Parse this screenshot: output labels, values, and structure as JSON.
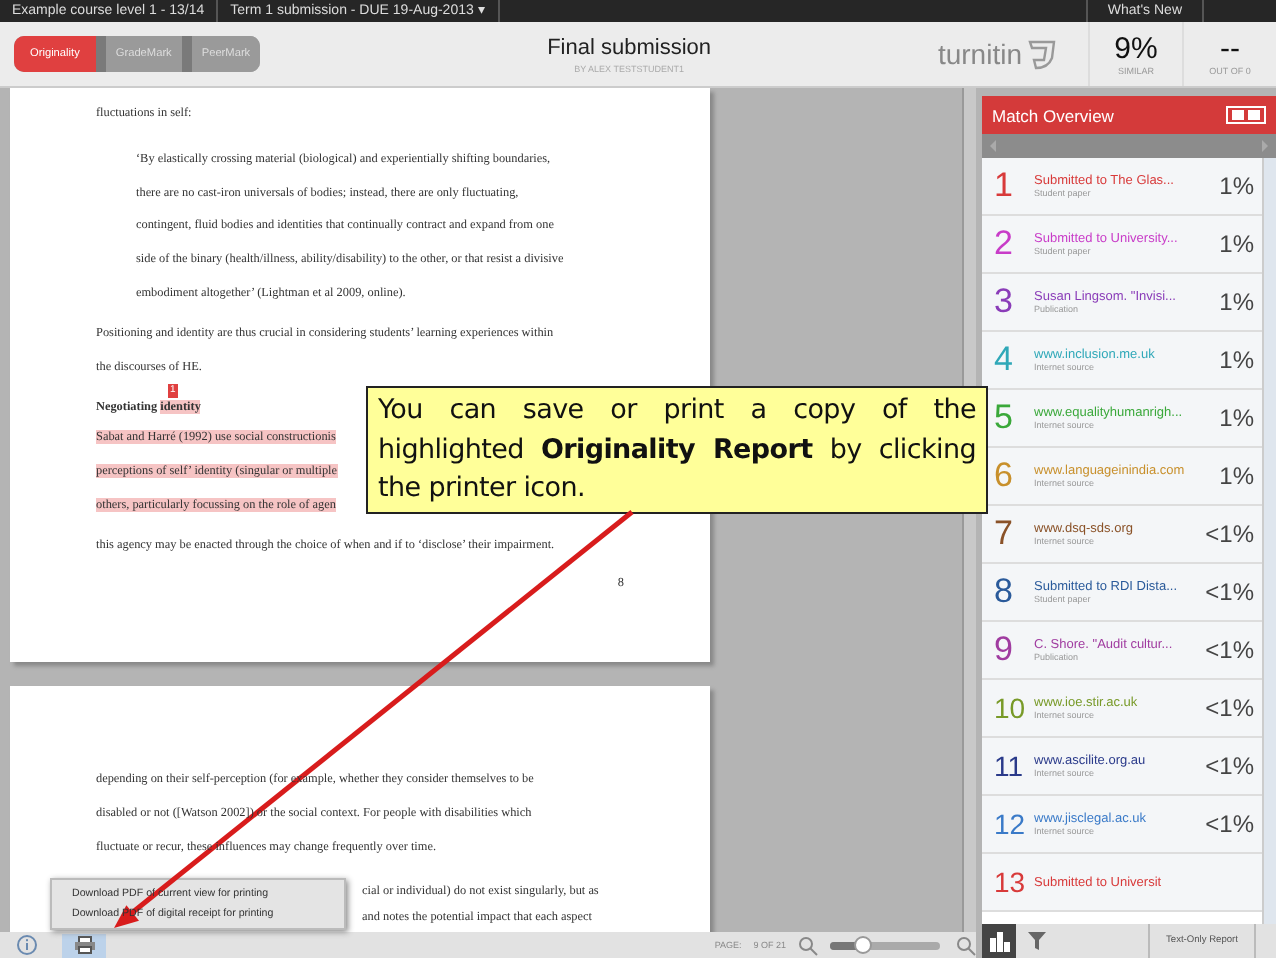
{
  "top_bar": {
    "course": "Example course level 1 - 13/14",
    "assignment": "Term 1 submission - DUE 19-Aug-2013 ▾",
    "whats_new": "What's New"
  },
  "header": {
    "tabs": [
      {
        "label": "Originality",
        "selected": true
      },
      {
        "label": "GradeMark",
        "selected": false
      },
      {
        "label": "PeerMark",
        "selected": false
      }
    ],
    "title": "Final submission",
    "author": "BY ALEX TESTSTUDENT1",
    "logo": "turnitin",
    "similarity": {
      "value": "9%",
      "label": "SIMILAR"
    },
    "grade": {
      "value": "--",
      "label": "OUT OF 0"
    }
  },
  "document": {
    "pages": [
      {
        "blocks": [
          {
            "kind": "para",
            "lines": [
              "fluctuations in self:"
            ]
          },
          {
            "kind": "quote",
            "lines": [
              "‘By elastically crossing material (biological) and experientially shifting boundaries,",
              "there are no cast-iron universals of bodies; instead, there are only fluctuating,",
              "contingent, fluid bodies and identities that continually contract and expand from one",
              "side of the binary (health/illness, ability/disability) to the other, or that resist a divisive",
              "embodiment altogether’ (Lightman et al 2009, online)."
            ]
          },
          {
            "kind": "para",
            "lines": [
              "Positioning and identity are thus crucial in considering students’ learning experiences within",
              "the discourses of HE."
            ]
          },
          {
            "kind": "heading",
            "lead": "Negotiating",
            "match": "identity",
            "marker": "1"
          },
          {
            "kind": "highlight",
            "lines": [
              "Sabat and Harré (1992) use social constructionis",
              "perceptions of self’ identity (singular or multiple",
              "others, particularly focussing on the role of agen"
            ]
          },
          {
            "kind": "para",
            "lines": [
              "this agency may be enacted through the choice of when and if to ‘disclose’ their impairment."
            ]
          },
          {
            "kind": "page_number",
            "text": "8"
          }
        ]
      },
      {
        "blocks": [
          {
            "kind": "para",
            "lines": [
              "depending on their self-perception (for example, whether they consider themselves to be",
              "disabled or not ([Watson 2002]) or the social context. For people with disabilities which",
              "fluctuate or recur, these influences may change frequently over time."
            ]
          },
          {
            "kind": "partial",
            "lines": [
              "cial or individual) do not exist singularly, but as",
              "and notes the potential impact that each aspect"
            ]
          }
        ]
      }
    ]
  },
  "download_menu": {
    "items": [
      "Download PDF of current view for printing",
      "Download PDF of digital receipt for printing"
    ]
  },
  "page_toolbar": {
    "page_label": "PAGE:",
    "page_value": "9 OF 21",
    "zoom": {
      "level": 0.3
    }
  },
  "match_overview": {
    "title": "Match Overview",
    "matches": [
      {
        "number": "1",
        "title": "Submitted to The Glas...",
        "type": "Student paper",
        "percent": "1%",
        "color": "#d83a3a"
      },
      {
        "number": "2",
        "title": "Submitted to University...",
        "type": "Student paper",
        "percent": "1%",
        "color": "#c83cc8"
      },
      {
        "number": "3",
        "title": "Susan Lingsom. \"Invisi...",
        "type": "Publication",
        "percent": "1%",
        "color": "#8a3cb8"
      },
      {
        "number": "4",
        "title": "www.inclusion.me.uk",
        "type": "Internet source",
        "percent": "1%",
        "color": "#2fa8b8"
      },
      {
        "number": "5",
        "title": "www.equalityhumanrigh...",
        "type": "Internet source",
        "percent": "1%",
        "color": "#3aa83a"
      },
      {
        "number": "6",
        "title": "www.languageinindia.com",
        "type": "Internet source",
        "percent": "1%",
        "color": "#c8902c"
      },
      {
        "number": "7",
        "title": "www.dsq-sds.org",
        "type": "Internet source",
        "percent": "<1%",
        "color": "#8a5228"
      },
      {
        "number": "8",
        "title": "Submitted to RDI Dista...",
        "type": "Student paper",
        "percent": "<1%",
        "color": "#2a5a9a"
      },
      {
        "number": "9",
        "title": "C. Shore. \"Audit cultur...",
        "type": "Publication",
        "percent": "<1%",
        "color": "#a03ca0"
      },
      {
        "number": "10",
        "title": "www.ioe.stir.ac.uk",
        "type": "Internet source",
        "percent": "<1%",
        "color": "#789a28"
      },
      {
        "number": "11",
        "title": "www.ascilite.org.au",
        "type": "Internet source",
        "percent": "<1%",
        "color": "#2a3a8a"
      },
      {
        "number": "12",
        "title": "www.jisclegal.ac.uk",
        "type": "Internet source",
        "percent": "<1%",
        "color": "#3a7ac8"
      },
      {
        "number": "13",
        "title": "Submitted to Universit",
        "color": "#d83a3a"
      }
    ]
  },
  "panel_toolbar": {
    "text_only": "Text-Only Report"
  },
  "callout": {
    "text": "You can save or print a copy of the highlighted **Originality Report** by clicking the printer icon."
  }
}
